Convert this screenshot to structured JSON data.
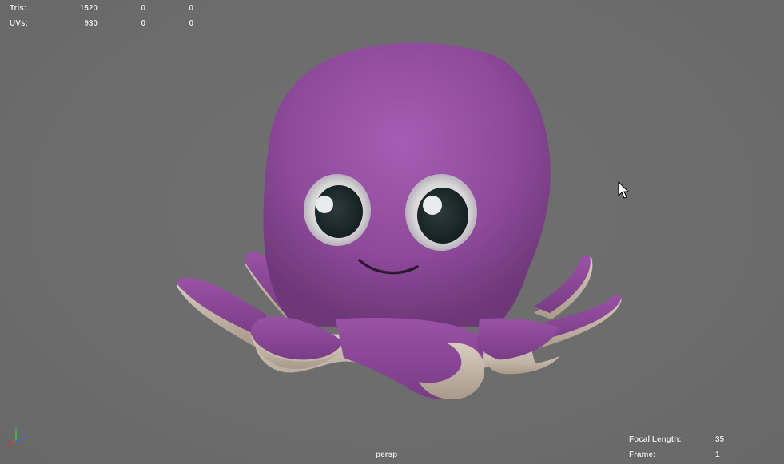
{
  "hud": {
    "stats": [
      {
        "label": "Tris:",
        "v1": "1520",
        "v2": "0",
        "v3": "0"
      },
      {
        "label": "UVs:",
        "v1": "930",
        "v2": "0",
        "v3": "0"
      }
    ],
    "camera_name": "persp",
    "camera_info": [
      {
        "label": "Focal Length:",
        "value": "35"
      },
      {
        "label": "Frame:",
        "value": "1"
      }
    ]
  },
  "axis": {
    "y": "Y",
    "z": "Z"
  },
  "colors": {
    "viewport_bg": "#6e6e6e",
    "octopus_body": "#9a4fa6",
    "octopus_underside": "#c9bdb0",
    "axis_x": "#d23c3c",
    "axis_y": "#3cc83c",
    "axis_z": "#3c6cdc"
  }
}
